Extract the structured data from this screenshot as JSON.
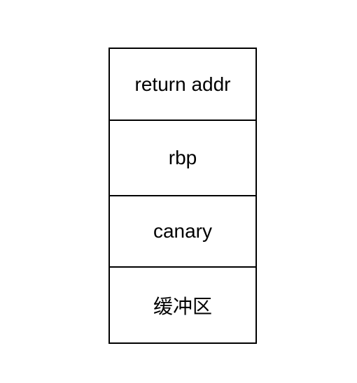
{
  "diagram": {
    "type": "stack-frame",
    "cells": [
      {
        "label": "return addr"
      },
      {
        "label": "rbp"
      },
      {
        "label": "canary"
      },
      {
        "label": "缓冲区"
      }
    ]
  }
}
